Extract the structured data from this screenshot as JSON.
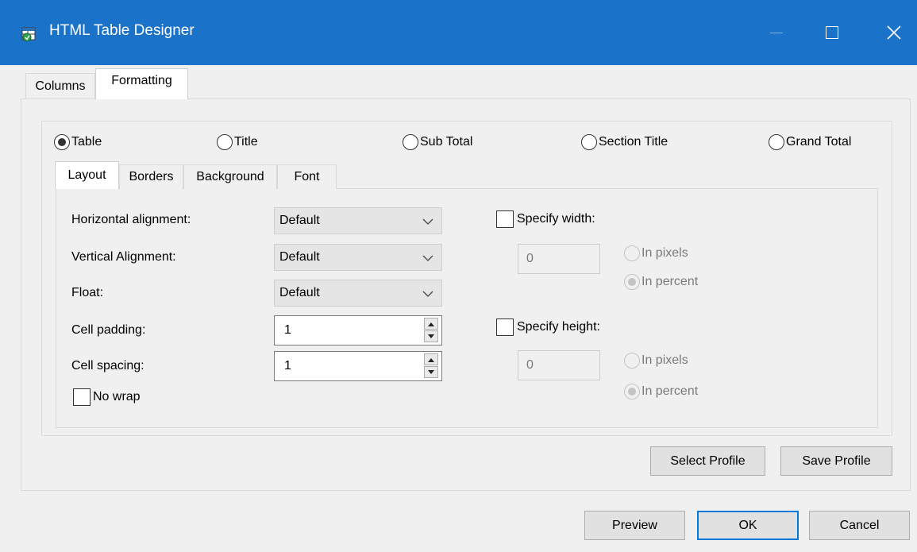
{
  "window": {
    "title": "HTML Table Designer",
    "icon": "app-icon",
    "accent_color": "#1a73c8"
  },
  "outer_tabs": [
    "Columns",
    "Formatting"
  ],
  "outer_active_tab": "Formatting",
  "element_radios": [
    {
      "label": "Table",
      "checked": true
    },
    {
      "label": "Title",
      "checked": false
    },
    {
      "label": "Sub Total",
      "checked": false
    },
    {
      "label": "Section Title",
      "checked": false
    },
    {
      "label": "Grand Total",
      "checked": false
    }
  ],
  "inner_tabs": [
    "Layout",
    "Borders",
    "Background",
    "Font"
  ],
  "inner_active_tab": "Layout",
  "layout": {
    "horizontal_alignment": {
      "label": "Horizontal alignment:",
      "value": "Default"
    },
    "vertical_alignment": {
      "label": "Vertical Alignment:",
      "value": "Default"
    },
    "float": {
      "label": "Float:",
      "value": "Default"
    },
    "cell_padding": {
      "label": "Cell padding:",
      "value": "1"
    },
    "cell_spacing": {
      "label": "Cell spacing:",
      "value": "1"
    },
    "no_wrap": {
      "label": "No wrap",
      "checked": false
    }
  },
  "width": {
    "label": "Specify width:",
    "checked": false,
    "value": "0",
    "pixels_label": "In pixels",
    "percent_label": "In percent",
    "unit": "percent"
  },
  "height": {
    "label": "Specify height:",
    "checked": false,
    "value": "0",
    "pixels_label": "In pixels",
    "percent_label": "In percent",
    "unit": "percent"
  },
  "profile_buttons": {
    "select": "Select Profile",
    "save": "Save Profile"
  },
  "dialog_buttons": {
    "preview": "Preview",
    "ok": "OK",
    "cancel": "Cancel"
  }
}
